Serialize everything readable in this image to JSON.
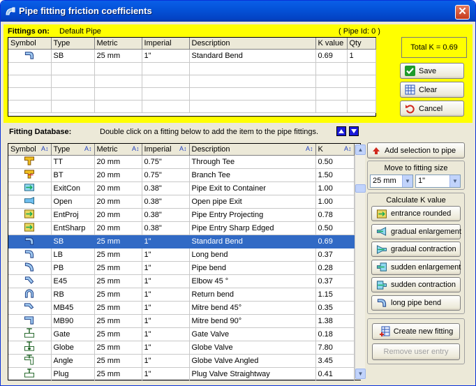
{
  "window": {
    "title": "Pipe fitting friction coefficients",
    "close_glyph": "✕"
  },
  "fittings_panel": {
    "heading": "Fittings on:",
    "pipe_name": "Default Pipe",
    "pipe_id": "( Pipe Id: 0 )",
    "columns": [
      "Symbol",
      "Type",
      "Metric",
      "Imperial",
      "Description",
      "K value",
      "Qty"
    ],
    "rows": [
      {
        "type": "SB",
        "metric": "25 mm",
        "imperial": "1\"",
        "description": "Standard Bend",
        "k": "0.69",
        "qty": "1",
        "icon": "standard-bend-icon"
      }
    ],
    "total_k": "Total K = 0.69",
    "buttons": {
      "save": "Save",
      "clear": "Clear",
      "cancel": "Cancel"
    }
  },
  "database": {
    "heading": "Fitting Database:",
    "hint": "Double click on a fitting below to add the item to the pipe fittings.",
    "columns": [
      "Symbol",
      "Type",
      "Metric",
      "Imperial",
      "Description",
      "K"
    ],
    "selected_index": 6,
    "rows": [
      {
        "type": "TT",
        "metric": "20 mm",
        "imperial": "0.75\"",
        "description": "Through Tee",
        "k": "0.50",
        "icon": "through-tee-icon"
      },
      {
        "type": "BT",
        "metric": "20 mm",
        "imperial": "0.75\"",
        "description": "Branch Tee",
        "k": "1.50",
        "icon": "branch-tee-icon"
      },
      {
        "type": "ExitCon",
        "metric": "20 mm",
        "imperial": "0.38\"",
        "description": "Pipe Exit to Container",
        "k": "1.00",
        "icon": "exit-container-icon"
      },
      {
        "type": "Open",
        "metric": "20 mm",
        "imperial": "0.38\"",
        "description": "Open pipe Exit",
        "k": "1.00",
        "icon": "open-exit-icon"
      },
      {
        "type": "EntProj",
        "metric": "20 mm",
        "imperial": "0.38\"",
        "description": "Pipe Entry Projecting",
        "k": "0.78",
        "icon": "entry-projecting-icon"
      },
      {
        "type": "EntSharp",
        "metric": "20 mm",
        "imperial": "0.38\"",
        "description": "Pipe Entry Sharp Edged",
        "k": "0.50",
        "icon": "entry-sharp-icon"
      },
      {
        "type": "SB",
        "metric": "25 mm",
        "imperial": "1\"",
        "description": "Standard Bend",
        "k": "0.69",
        "icon": "standard-bend-icon"
      },
      {
        "type": "LB",
        "metric": "25 mm",
        "imperial": "1\"",
        "description": "Long bend",
        "k": "0.37",
        "icon": "long-bend-icon"
      },
      {
        "type": "PB",
        "metric": "25 mm",
        "imperial": "1\"",
        "description": "Pipe bend",
        "k": "0.28",
        "icon": "pipe-bend-icon"
      },
      {
        "type": "E45",
        "metric": "25 mm",
        "imperial": "1\"",
        "description": "Elbow 45 °",
        "k": "0.37",
        "icon": "elbow-45-icon"
      },
      {
        "type": "RB",
        "metric": "25 mm",
        "imperial": "1\"",
        "description": "Return bend",
        "k": "1.15",
        "icon": "return-bend-icon"
      },
      {
        "type": "MB45",
        "metric": "25 mm",
        "imperial": "1\"",
        "description": "Mitre bend 45°",
        "k": "0.35",
        "icon": "mitre-bend-45-icon"
      },
      {
        "type": "MB90",
        "metric": "25 mm",
        "imperial": "1\"",
        "description": "Mitre bend 90°",
        "k": "1.38",
        "icon": "mitre-bend-90-icon"
      },
      {
        "type": "Gate",
        "metric": "25 mm",
        "imperial": "1\"",
        "description": "Gate Valve",
        "k": "0.18",
        "icon": "gate-valve-icon"
      },
      {
        "type": "Globe",
        "metric": "25 mm",
        "imperial": "1\"",
        "description": "Globe Valve",
        "k": "7.80",
        "icon": "globe-valve-icon"
      },
      {
        "type": "Angle",
        "metric": "25 mm",
        "imperial": "1\"",
        "description": "Globe Valve  Angled",
        "k": "3.45",
        "icon": "angle-valve-icon"
      },
      {
        "type": "Plug",
        "metric": "25 mm",
        "imperial": "1\"",
        "description": "Plug Valve Straightway",
        "k": "0.41",
        "icon": "plug-valve-icon"
      }
    ]
  },
  "right_panel": {
    "add_selection": "Add selection to pipe",
    "move_label": "Move to fitting size",
    "metric_size": "25 mm",
    "imperial_size": "1\"",
    "calc_label": "Calculate K value",
    "calc_buttons": [
      "entrance rounded",
      "gradual enlargement",
      "gradual contraction",
      "sudden enlargement",
      "sudden contraction",
      "long pipe bend"
    ],
    "create_new": "Create new fitting",
    "remove_user": "Remove user entry"
  },
  "colors": {
    "panel_yellow": "#ffff00",
    "selection_blue": "#316ac5",
    "title_blue": "#0453d9",
    "window_bg": "#ece9d8"
  }
}
